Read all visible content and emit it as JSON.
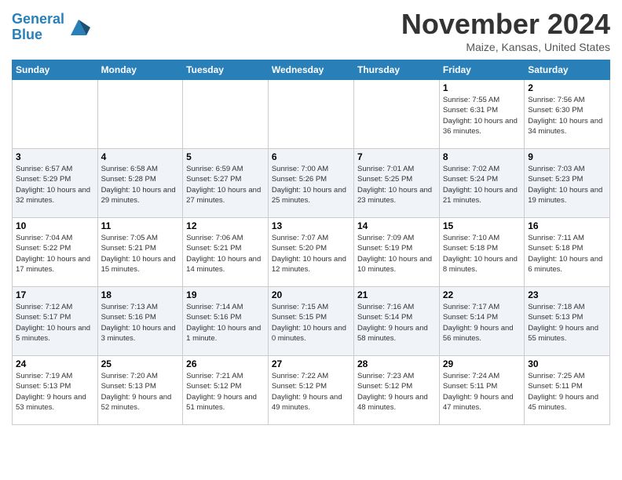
{
  "header": {
    "logo_line1": "General",
    "logo_line2": "Blue",
    "title": "November 2024",
    "location": "Maize, Kansas, United States"
  },
  "days_of_week": [
    "Sunday",
    "Monday",
    "Tuesday",
    "Wednesday",
    "Thursday",
    "Friday",
    "Saturday"
  ],
  "weeks": [
    [
      {
        "day": "",
        "info": ""
      },
      {
        "day": "",
        "info": ""
      },
      {
        "day": "",
        "info": ""
      },
      {
        "day": "",
        "info": ""
      },
      {
        "day": "",
        "info": ""
      },
      {
        "day": "1",
        "info": "Sunrise: 7:55 AM\nSunset: 6:31 PM\nDaylight: 10 hours and 36 minutes."
      },
      {
        "day": "2",
        "info": "Sunrise: 7:56 AM\nSunset: 6:30 PM\nDaylight: 10 hours and 34 minutes."
      }
    ],
    [
      {
        "day": "3",
        "info": "Sunrise: 6:57 AM\nSunset: 5:29 PM\nDaylight: 10 hours and 32 minutes."
      },
      {
        "day": "4",
        "info": "Sunrise: 6:58 AM\nSunset: 5:28 PM\nDaylight: 10 hours and 29 minutes."
      },
      {
        "day": "5",
        "info": "Sunrise: 6:59 AM\nSunset: 5:27 PM\nDaylight: 10 hours and 27 minutes."
      },
      {
        "day": "6",
        "info": "Sunrise: 7:00 AM\nSunset: 5:26 PM\nDaylight: 10 hours and 25 minutes."
      },
      {
        "day": "7",
        "info": "Sunrise: 7:01 AM\nSunset: 5:25 PM\nDaylight: 10 hours and 23 minutes."
      },
      {
        "day": "8",
        "info": "Sunrise: 7:02 AM\nSunset: 5:24 PM\nDaylight: 10 hours and 21 minutes."
      },
      {
        "day": "9",
        "info": "Sunrise: 7:03 AM\nSunset: 5:23 PM\nDaylight: 10 hours and 19 minutes."
      }
    ],
    [
      {
        "day": "10",
        "info": "Sunrise: 7:04 AM\nSunset: 5:22 PM\nDaylight: 10 hours and 17 minutes."
      },
      {
        "day": "11",
        "info": "Sunrise: 7:05 AM\nSunset: 5:21 PM\nDaylight: 10 hours and 15 minutes."
      },
      {
        "day": "12",
        "info": "Sunrise: 7:06 AM\nSunset: 5:21 PM\nDaylight: 10 hours and 14 minutes."
      },
      {
        "day": "13",
        "info": "Sunrise: 7:07 AM\nSunset: 5:20 PM\nDaylight: 10 hours and 12 minutes."
      },
      {
        "day": "14",
        "info": "Sunrise: 7:09 AM\nSunset: 5:19 PM\nDaylight: 10 hours and 10 minutes."
      },
      {
        "day": "15",
        "info": "Sunrise: 7:10 AM\nSunset: 5:18 PM\nDaylight: 10 hours and 8 minutes."
      },
      {
        "day": "16",
        "info": "Sunrise: 7:11 AM\nSunset: 5:18 PM\nDaylight: 10 hours and 6 minutes."
      }
    ],
    [
      {
        "day": "17",
        "info": "Sunrise: 7:12 AM\nSunset: 5:17 PM\nDaylight: 10 hours and 5 minutes."
      },
      {
        "day": "18",
        "info": "Sunrise: 7:13 AM\nSunset: 5:16 PM\nDaylight: 10 hours and 3 minutes."
      },
      {
        "day": "19",
        "info": "Sunrise: 7:14 AM\nSunset: 5:16 PM\nDaylight: 10 hours and 1 minute."
      },
      {
        "day": "20",
        "info": "Sunrise: 7:15 AM\nSunset: 5:15 PM\nDaylight: 10 hours and 0 minutes."
      },
      {
        "day": "21",
        "info": "Sunrise: 7:16 AM\nSunset: 5:14 PM\nDaylight: 9 hours and 58 minutes."
      },
      {
        "day": "22",
        "info": "Sunrise: 7:17 AM\nSunset: 5:14 PM\nDaylight: 9 hours and 56 minutes."
      },
      {
        "day": "23",
        "info": "Sunrise: 7:18 AM\nSunset: 5:13 PM\nDaylight: 9 hours and 55 minutes."
      }
    ],
    [
      {
        "day": "24",
        "info": "Sunrise: 7:19 AM\nSunset: 5:13 PM\nDaylight: 9 hours and 53 minutes."
      },
      {
        "day": "25",
        "info": "Sunrise: 7:20 AM\nSunset: 5:13 PM\nDaylight: 9 hours and 52 minutes."
      },
      {
        "day": "26",
        "info": "Sunrise: 7:21 AM\nSunset: 5:12 PM\nDaylight: 9 hours and 51 minutes."
      },
      {
        "day": "27",
        "info": "Sunrise: 7:22 AM\nSunset: 5:12 PM\nDaylight: 9 hours and 49 minutes."
      },
      {
        "day": "28",
        "info": "Sunrise: 7:23 AM\nSunset: 5:12 PM\nDaylight: 9 hours and 48 minutes."
      },
      {
        "day": "29",
        "info": "Sunrise: 7:24 AM\nSunset: 5:11 PM\nDaylight: 9 hours and 47 minutes."
      },
      {
        "day": "30",
        "info": "Sunrise: 7:25 AM\nSunset: 5:11 PM\nDaylight: 9 hours and 45 minutes."
      }
    ]
  ]
}
